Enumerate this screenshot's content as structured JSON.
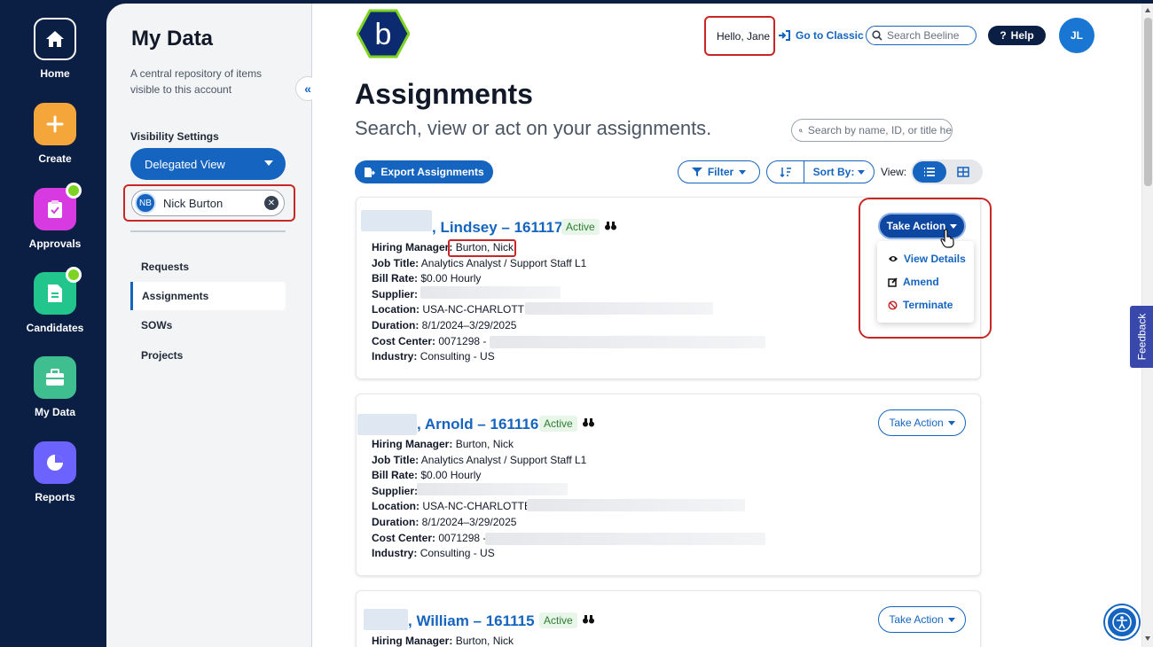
{
  "rail": {
    "items": [
      {
        "label": "Home",
        "icon": "home-icon",
        "color": "#0b1f45"
      },
      {
        "label": "Create",
        "icon": "plus-icon",
        "color": "#f5a63b"
      },
      {
        "label": "Approvals",
        "icon": "clipboard-check-icon",
        "color": "#d63ae0"
      },
      {
        "label": "Candidates",
        "icon": "document-icon",
        "color": "#22c58b"
      },
      {
        "label": "My Data",
        "icon": "briefcase-icon",
        "color": "#3fbf8f"
      },
      {
        "label": "Reports",
        "icon": "pie-chart-icon",
        "color": "#6c63ff"
      }
    ]
  },
  "sidebar": {
    "title": "My Data",
    "description": "A central repository of items visible to this account",
    "visibility_label": "Visibility Settings",
    "view_select": "Delegated View",
    "delegate": {
      "initials": "NB",
      "name": "Nick Burton"
    },
    "nav": [
      "Requests",
      "Assignments",
      "SOWs",
      "Projects"
    ],
    "active_nav": "Assignments"
  },
  "header": {
    "hello": "Hello, Jane",
    "go_classic": "Go to Classic",
    "search_placeholder": "Search Beeline",
    "help": "Help",
    "avatar_initials": "JL",
    "logo_letter": "b"
  },
  "page": {
    "title": "Assignments",
    "subtitle": "Search, view or act on your assignments.",
    "search_placeholder": "Search by name, ID, or title he",
    "export": "Export Assignments",
    "filter": "Filter",
    "sort": "Sort By:",
    "view_label": "View:"
  },
  "labels": {
    "hiring_manager": "Hiring Manager:",
    "job_title": "Job Title:",
    "bill_rate": "Bill Rate:",
    "supplier": "Supplier:",
    "location": "Location:",
    "duration": "Duration:",
    "cost_center": "Cost Center:",
    "industry": "Industry:",
    "take_action": "Take Action"
  },
  "assignments": [
    {
      "name": ", Lindsey – 161117",
      "status": "Active",
      "hiring_manager": "Burton, Nick",
      "job_title": "Analytics Analyst / Support Staff L1",
      "bill_rate": "$0.00 Hourly",
      "location": "USA-NC-CHARLOTTE-1",
      "duration": "8/1/2024–3/29/2025",
      "cost_center": "0071298 - 8",
      "industry": "Consulting - US"
    },
    {
      "name": ", Arnold – 161116",
      "status": "Active",
      "hiring_manager": "Burton, Nick",
      "job_title": "Analytics Analyst / Support Staff L1",
      "bill_rate": "$0.00 Hourly",
      "location": "USA-NC-CHARLOTTE-1",
      "duration": "8/1/2024–3/29/2025",
      "cost_center": "0071298 -",
      "industry": "Consulting - US"
    },
    {
      "name": ", William – 161115",
      "status": "Active",
      "hiring_manager": "Burton, Nick"
    }
  ],
  "action_menu": {
    "items": [
      {
        "label": "View Details",
        "icon": "eye-icon"
      },
      {
        "label": "Amend",
        "icon": "edit-icon"
      },
      {
        "label": "Terminate",
        "icon": "ban-icon"
      }
    ]
  },
  "feedback": "Feedback",
  "colors": {
    "brand": "#1565c0",
    "rail": "#0b1f45",
    "highlight": "#c62828",
    "active_status": "#2e7d32"
  }
}
